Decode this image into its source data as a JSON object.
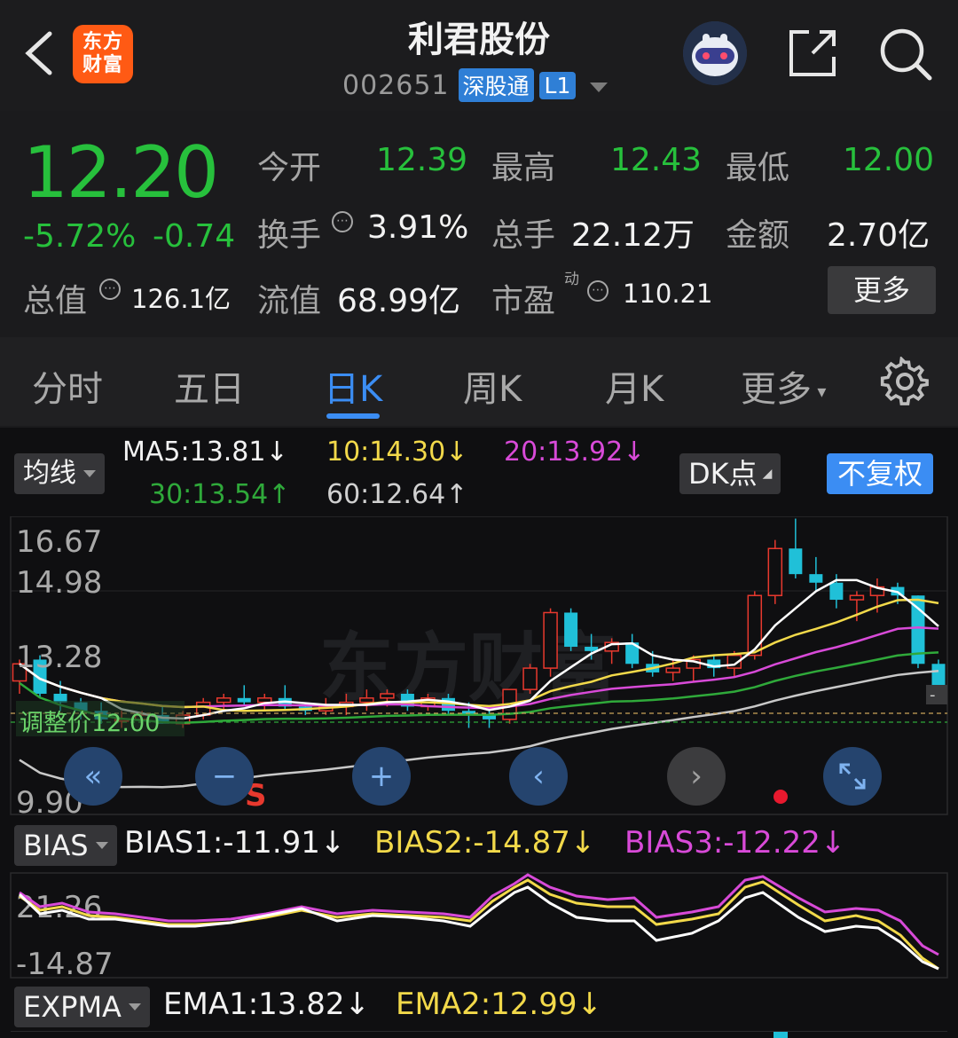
{
  "header": {
    "logo_line1": "东方",
    "logo_line2": "财富",
    "stock_name": "利君股份",
    "stock_code": "002651",
    "badge_connect": "深股通",
    "badge_level": "L1"
  },
  "quote": {
    "price": "12.20",
    "change_pct": "-5.72%",
    "change_amt": "-0.74",
    "open_label": "今开",
    "open": "12.39",
    "high_label": "最高",
    "high": "12.43",
    "low_label": "最低",
    "low": "12.00",
    "turnover_label": "换手",
    "turnover": "3.91%",
    "volume_label": "总手",
    "volume": "22.12万",
    "amount_label": "金额",
    "amount": "2.70亿",
    "mktcap_label": "总值",
    "mktcap": "126.1亿",
    "float_label": "流值",
    "float": "68.99亿",
    "pe_label": "市盈",
    "pe_sup": "动",
    "pe": "110.21",
    "more_label": "更多"
  },
  "tabs": [
    "分时",
    "五日",
    "日K",
    "周K",
    "月K",
    "更多"
  ],
  "active_tab": "日K",
  "ma_bar": {
    "selector": "均线",
    "ma5": "MA5:13.81↓",
    "ma10": "10:14.30↓",
    "ma20": "20:13.92↓",
    "ma30": "30:13.54↑",
    "ma60": "60:12.64↑",
    "dk_label": "DK点",
    "adjust_label": "不复权"
  },
  "colors": {
    "up": "#e8392e",
    "down": "#20c0d8",
    "ma5": "#ffffff",
    "ma10": "#f2d94a",
    "ma20": "#d84ad8",
    "ma30": "#2fa93a",
    "ma60": "#c8c8c8",
    "accent": "#3b8df3"
  },
  "chart_data": [
    {
      "type": "candlestick",
      "title": "",
      "y_labels": [
        "16.67",
        "14.98",
        "13.28",
        "9.90"
      ],
      "ylim": [
        9.9,
        16.67
      ],
      "current_price_label": "调整价12.00",
      "buy_sell_marker": "S",
      "watermark": "东方财富",
      "candles_ohlc": [
        [
          12.9,
          13.4,
          12.6,
          13.3
        ],
        [
          13.4,
          13.5,
          12.5,
          12.6
        ],
        [
          12.6,
          12.9,
          12.2,
          12.4
        ],
        [
          12.4,
          12.5,
          12.0,
          12.2
        ],
        [
          12.2,
          12.4,
          11.9,
          12.0
        ],
        [
          12.0,
          12.2,
          11.8,
          12.0
        ],
        [
          12.0,
          12.2,
          11.9,
          12.1
        ],
        [
          12.1,
          12.3,
          11.9,
          11.9
        ],
        [
          11.9,
          12.2,
          11.8,
          12.1
        ],
        [
          12.1,
          12.5,
          12.0,
          12.4
        ],
        [
          12.4,
          12.6,
          12.2,
          12.5
        ],
        [
          12.5,
          12.8,
          12.3,
          12.4
        ],
        [
          12.4,
          12.6,
          12.2,
          12.5
        ],
        [
          12.5,
          12.8,
          12.2,
          12.3
        ],
        [
          12.3,
          12.4,
          12.1,
          12.2
        ],
        [
          12.2,
          12.5,
          12.1,
          12.3
        ],
        [
          12.3,
          12.6,
          12.1,
          12.4
        ],
        [
          12.4,
          12.7,
          12.2,
          12.5
        ],
        [
          12.5,
          12.7,
          12.3,
          12.6
        ],
        [
          12.6,
          12.7,
          12.2,
          12.3
        ],
        [
          12.3,
          12.6,
          12.2,
          12.5
        ],
        [
          12.5,
          12.6,
          12.1,
          12.2
        ],
        [
          12.2,
          12.4,
          11.8,
          12.1
        ],
        [
          12.1,
          12.3,
          11.8,
          12.0
        ],
        [
          12.0,
          12.7,
          11.9,
          12.7
        ],
        [
          12.7,
          13.3,
          12.6,
          13.2
        ],
        [
          13.2,
          14.6,
          13.0,
          14.5
        ],
        [
          14.5,
          14.6,
          13.6,
          13.7
        ],
        [
          13.7,
          14.0,
          13.4,
          13.6
        ],
        [
          13.6,
          13.9,
          13.3,
          13.8
        ],
        [
          13.8,
          14.0,
          13.2,
          13.3
        ],
        [
          13.3,
          13.6,
          13.0,
          13.1
        ],
        [
          13.1,
          13.4,
          12.9,
          13.2
        ],
        [
          13.2,
          13.5,
          12.9,
          13.4
        ],
        [
          13.4,
          13.5,
          13.0,
          13.2
        ],
        [
          13.2,
          13.6,
          13.0,
          13.5
        ],
        [
          13.5,
          15.0,
          13.4,
          14.9
        ],
        [
          14.9,
          16.2,
          14.7,
          16.0
        ],
        [
          16.0,
          16.7,
          15.3,
          15.4
        ],
        [
          15.4,
          15.8,
          15.0,
          15.2
        ],
        [
          15.2,
          15.4,
          14.6,
          14.8
        ],
        [
          14.8,
          15.0,
          14.3,
          14.9
        ],
        [
          14.9,
          15.3,
          14.5,
          15.1
        ],
        [
          15.1,
          15.2,
          14.7,
          14.9
        ],
        [
          14.9,
          14.9,
          13.2,
          13.3
        ],
        [
          13.3,
          13.4,
          12.6,
          12.7
        ]
      ]
    },
    {
      "type": "line",
      "name": "BIAS",
      "labels": {
        "selector": "BIAS",
        "bias1": "BIAS1:-11.91↓",
        "bias2": "BIAS2:-14.87↓",
        "bias3": "BIAS3:-12.22↓"
      },
      "y_labels": [
        "21.26",
        "-14.87"
      ],
      "ylim": [
        -14.87,
        21.26
      ]
    },
    {
      "type": "line",
      "name": "EXPMA",
      "labels": {
        "selector": "EXPMA",
        "ema1": "EMA1:13.82↓",
        "ema2": "EMA2:12.99↓"
      }
    }
  ]
}
